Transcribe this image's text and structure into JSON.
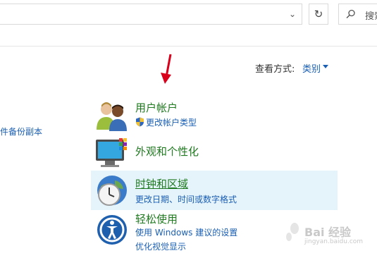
{
  "toolbar": {
    "address_dropdown_icon": "chevron-down-icon",
    "refresh_icon": "refresh-icon",
    "refresh_glyph": "↻",
    "search_placeholder": "搜索"
  },
  "view_by": {
    "label": "查看方式:",
    "value": "类别"
  },
  "left_panel": {
    "link": "件备份副本"
  },
  "categories": [
    {
      "title": "用户帐户",
      "links": [
        "更改帐户类型"
      ],
      "icon": "users-icon"
    },
    {
      "title": "外观和个性化",
      "links": [],
      "icon": "appearance-icon"
    },
    {
      "title": "时钟和区域",
      "links": [
        "更改日期、时间或数字格式"
      ],
      "icon": "clock-globe-icon"
    },
    {
      "title": "轻松使用",
      "links": [
        "使用 Windows 建议的设置",
        "优化视觉显示"
      ],
      "icon": "ease-of-access-icon"
    }
  ],
  "watermark": {
    "text": "Bai 经验",
    "sub": "jingyan.baidu.com"
  },
  "colors": {
    "category_title": "#1f7a1f",
    "link": "#1a5fb4",
    "highlight": "#e5f3fb",
    "arrow": "#d9001b"
  }
}
